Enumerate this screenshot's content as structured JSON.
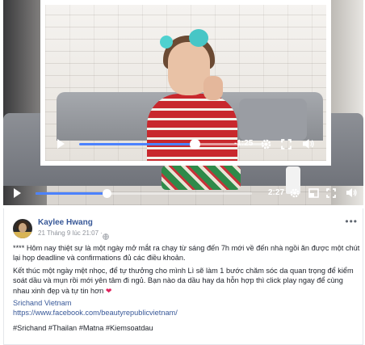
{
  "background_player": {
    "time": "2:27",
    "progress_fraction": 0.33,
    "icons": [
      "play-icon",
      "settings-icon",
      "theater-icon",
      "fullscreen-icon",
      "volume-icon"
    ]
  },
  "inset_player": {
    "time": "-1:25",
    "progress_fraction": 0.62,
    "icons": [
      "play-icon",
      "settings-icon",
      "fullscreen-icon",
      "volume-icon"
    ]
  },
  "post": {
    "author": "Kaylee Hwang",
    "timestamp": "21 Tháng 9 lúc 21:07 ·",
    "more_label": "•••",
    "paragraph_1": "**** Hôm nay thiệt sự là một ngày mở mắt ra chạy từ sáng đến 7h mới về đến nhà ngồi ăn được một chút lại họp deadline và confirmations đủ các điều khoản.",
    "paragraph_2": "Kết thúc một ngày mệt nhọc, để tự thưởng cho mình Lì sẽ làm 1 bước chăm sóc da quan trọng để kiểm soát dầu và mụn rồi mới yên tâm đi ngủ. Bạn nào da dầu hay da hỗn hợp thì click play ngay để cùng nhau xinh đẹp và tự tin hơn",
    "heart": "❤",
    "link_page": "Srichand Vietnam",
    "link_url": "https://www.facebook.com/beautyrepublicvietnam/",
    "hashtags": "#Srichand #Thailan #Matna #Kiemsoatdau"
  }
}
